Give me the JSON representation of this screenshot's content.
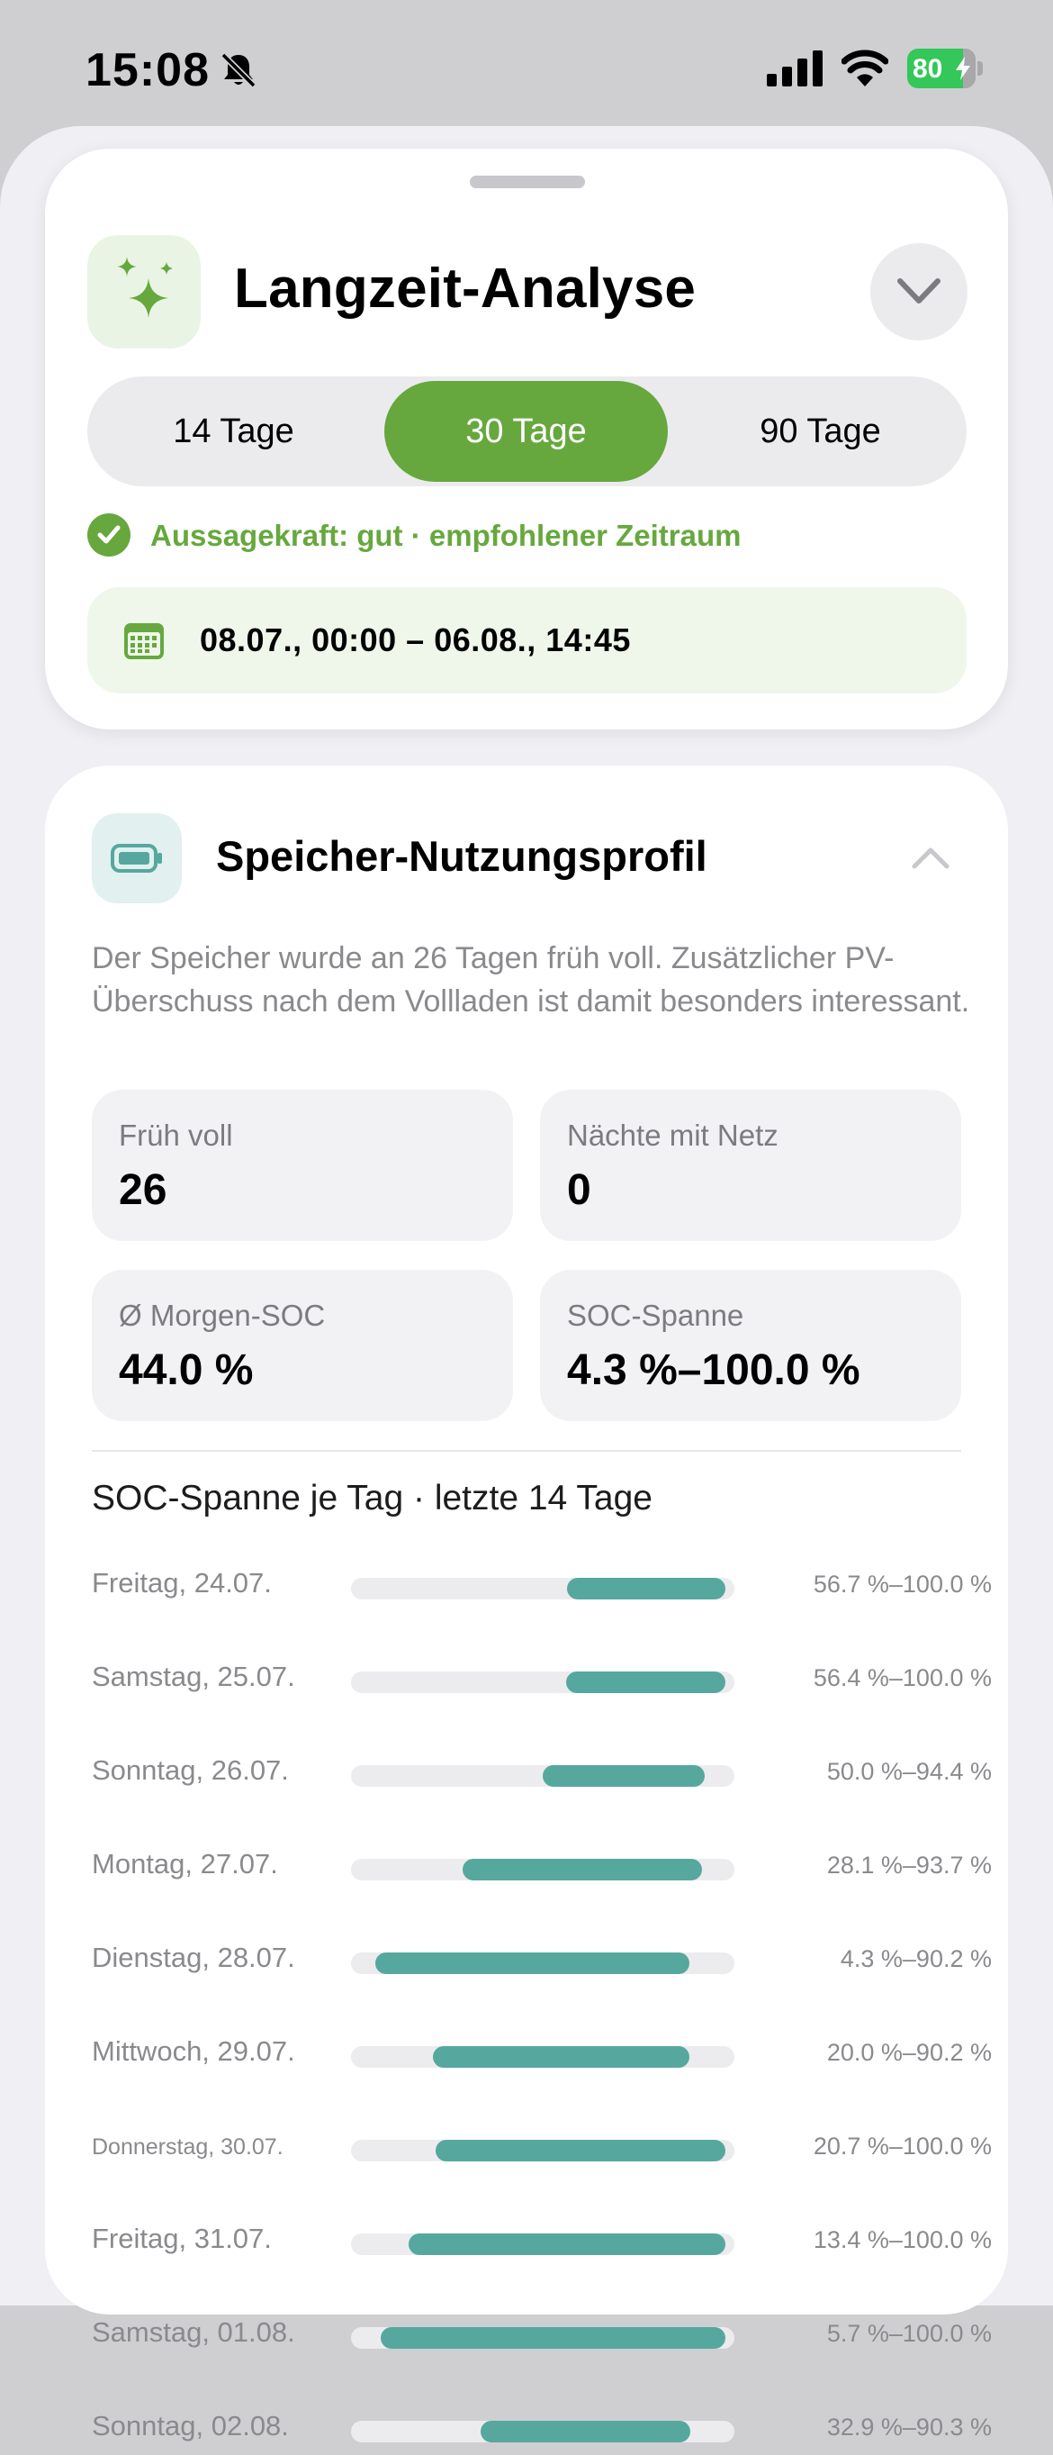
{
  "status_bar": {
    "time": "15:08",
    "battery_percent": "80",
    "icons": [
      "bell-slash-icon",
      "cellular-signal-icon",
      "wifi-icon",
      "battery-charging-icon"
    ]
  },
  "analysis_card": {
    "title": "Langzeit-Analyse",
    "icon": "sparkles-icon",
    "collapse_icon": "chevron-down-icon",
    "periods": [
      "14 Tage",
      "30 Tage",
      "90 Tage"
    ],
    "selected_period": "30 Tage",
    "quality_text": "Aussagekraft: gut · empfohlener Zeitraum",
    "date_range": "08.07., 00:00 – 06.08., 14:45",
    "accent_color": "#66a83e"
  },
  "storage_card": {
    "title": "Speicher-Nutzungsprofil",
    "icon": "battery-icon",
    "collapse_icon": "chevron-up-icon",
    "description": "Der Speicher wurde an 26 Tagen früh voll. Zusätzlicher PV-Überschuss nach dem Vollladen ist damit besonders interessant.",
    "stats": [
      {
        "label": "Früh voll",
        "value": "26"
      },
      {
        "label": "Nächte mit Netz",
        "value": "0"
      },
      {
        "label": "Ø Morgen-SOC",
        "value": "44.0 %"
      },
      {
        "label": "SOC-Spanne",
        "value": "4.3 %–100.0 %"
      }
    ],
    "chart_title": "SOC-Spanne je Tag · letzte 14 Tage",
    "bar_color": "#56a89e"
  },
  "chart_data": {
    "type": "bar",
    "title": "SOC-Spanne je Tag · letzte 14 Tage",
    "xlim": [
      0,
      100
    ],
    "categories": [
      "Freitag, 24.07.",
      "Samstag, 25.07.",
      "Sonntag, 26.07.",
      "Montag, 27.07.",
      "Dienstag, 28.07.",
      "Mittwoch, 29.07.",
      "Donnerstag, 30.07.",
      "Freitag, 31.07.",
      "Samstag, 01.08.",
      "Sonntag, 02.08."
    ],
    "ranges": [
      {
        "min": 56.7,
        "max": 100.0,
        "label": "56.7 %–100.0 %"
      },
      {
        "min": 56.4,
        "max": 100.0,
        "label": "56.4 %–100.0 %"
      },
      {
        "min": 50.0,
        "max": 94.4,
        "label": "50.0 %–94.4 %"
      },
      {
        "min": 28.1,
        "max": 93.7,
        "label": "28.1 %–93.7 %"
      },
      {
        "min": 4.3,
        "max": 90.2,
        "label": "4.3 %–90.2 %"
      },
      {
        "min": 20.0,
        "max": 90.2,
        "label": "20.0 %–90.2 %"
      },
      {
        "min": 20.7,
        "max": 100.0,
        "label": "20.7 %–100.0 %"
      },
      {
        "min": 13.4,
        "max": 100.0,
        "label": "13.4 %–100.0 %"
      },
      {
        "min": 5.7,
        "max": 100.0,
        "label": "5.7 %–100.0 %"
      },
      {
        "min": 32.9,
        "max": 90.3,
        "label": "32.9 %–90.3 %"
      }
    ]
  }
}
